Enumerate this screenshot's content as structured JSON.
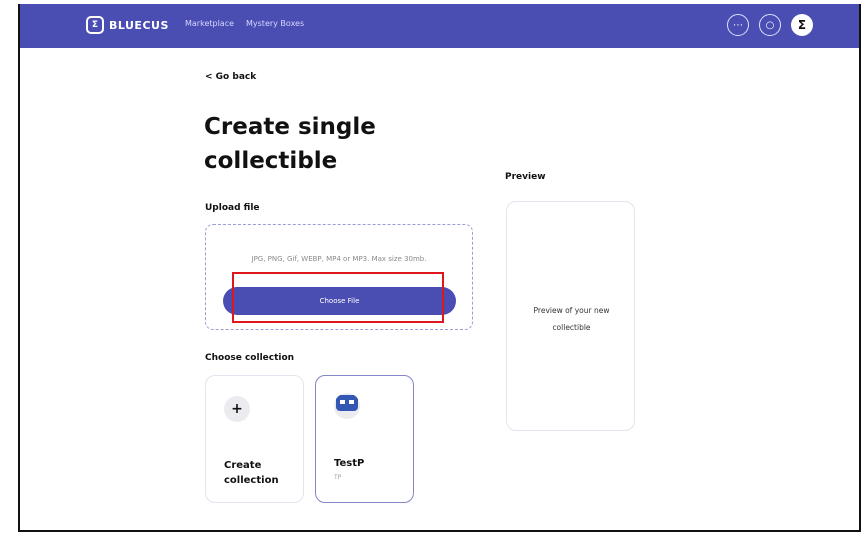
{
  "header": {
    "logo_text": "BLUECUS",
    "nav": {
      "marketplace": "Marketplace",
      "mystery_boxes": "Mystery Boxes"
    },
    "icons": {
      "more": "more-icon",
      "search": "search-icon",
      "profile": "profile-icon"
    },
    "profile_glyph": "Σ",
    "more_glyph": "⋯",
    "search_glyph": "○"
  },
  "main": {
    "go_back": "< Go back",
    "title": "Create single collectible",
    "upload": {
      "label": "Upload file",
      "hint": "JPG, PNG, Gif, WEBP, MP4 or MP3. Max size 30mb.",
      "button_label": "Choose File"
    },
    "collection": {
      "label": "Choose collection",
      "create_icon": "+",
      "create_label": "Create collection",
      "items": [
        {
          "name": "TestP",
          "symbol": "TP"
        }
      ]
    },
    "preview": {
      "label": "Preview",
      "placeholder": "Preview of your new collectible"
    }
  },
  "colors": {
    "brand": "#4a4eb3",
    "highlight": "#e0161e"
  }
}
